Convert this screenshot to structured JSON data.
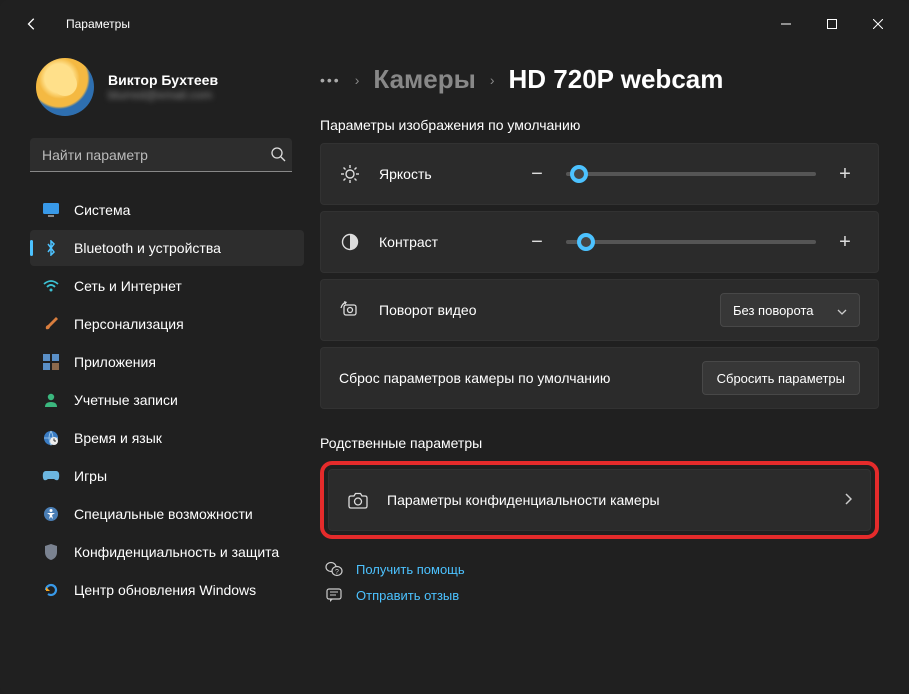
{
  "titlebar": {
    "title": "Параметры"
  },
  "profile": {
    "name": "Виктор Бухтеев",
    "email": "blurred@email.com"
  },
  "search": {
    "placeholder": "Найти параметр"
  },
  "nav": {
    "items": [
      {
        "label": "Система"
      },
      {
        "label": "Bluetooth и устройства"
      },
      {
        "label": "Сеть и Интернет"
      },
      {
        "label": "Персонализация"
      },
      {
        "label": "Приложения"
      },
      {
        "label": "Учетные записи"
      },
      {
        "label": "Время и язык"
      },
      {
        "label": "Игры"
      },
      {
        "label": "Специальные возможности"
      },
      {
        "label": "Конфиденциальность и защита"
      },
      {
        "label": "Центр обновления Windows"
      }
    ]
  },
  "breadcrumb": {
    "link": "Камеры",
    "current": "HD 720P webcam"
  },
  "section1": {
    "label": "Параметры изображения по умолчанию"
  },
  "brightness": {
    "label": "Яркость",
    "value": 5
  },
  "contrast": {
    "label": "Контраст",
    "value": 8
  },
  "rotation": {
    "label": "Поворот видео",
    "selected": "Без поворота"
  },
  "reset": {
    "label": "Сброс параметров камеры по умолчанию",
    "button": "Сбросить параметры"
  },
  "section2": {
    "label": "Родственные параметры"
  },
  "privacy": {
    "label": "Параметры конфиденциальности камеры"
  },
  "help": {
    "label": "Получить помощь"
  },
  "feedback": {
    "label": "Отправить отзыв"
  }
}
